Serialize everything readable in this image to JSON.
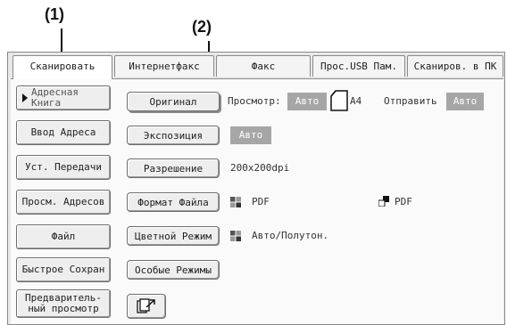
{
  "callouts": {
    "c1": "(1)",
    "c2": "(2)"
  },
  "tabs": [
    {
      "label": "Сканировать",
      "active": true
    },
    {
      "label": "Интернетфакс",
      "active": false
    },
    {
      "label": "Факс",
      "active": false
    },
    {
      "label": "Прос.USB Пам.",
      "active": false
    },
    {
      "label": "Сканиров. в ПК",
      "active": false
    }
  ],
  "sidebar": {
    "address_book_line1": "Адресная",
    "address_book_line2": "Книга",
    "address_entry": "Ввод Адреса",
    "send_settings": "Уст. Передачи",
    "address_review": "Просм. Адресов",
    "file": "Файл",
    "quick_save": "Быстрое Сохран",
    "preview_line1": "Предваритель-",
    "preview_line2": "ный просмотр"
  },
  "settings": {
    "original_button": "Оригинал",
    "preview_label": "Просмотр:",
    "preview_value": "Авто",
    "paper_size": "A4",
    "send_label": "Отправить",
    "send_value": "Авто",
    "exposure_button": "Экспозиция",
    "exposure_value": "Авто",
    "resolution_button": "Разрешение",
    "resolution_value": "200x200dpi",
    "file_format_button": "Формат Файла",
    "file_format_color": "PDF",
    "file_format_bw": "PDF",
    "color_mode_button": "Цветной Режим",
    "color_mode_value": "Авто/Полутон.",
    "special_modes_button": "Особые Режимы"
  },
  "icons": {
    "document-page-icon": "page outline",
    "color-quad-icon": "four squares",
    "bw-file-icon": "two squares",
    "send-preview-icon": "arrow to page"
  }
}
